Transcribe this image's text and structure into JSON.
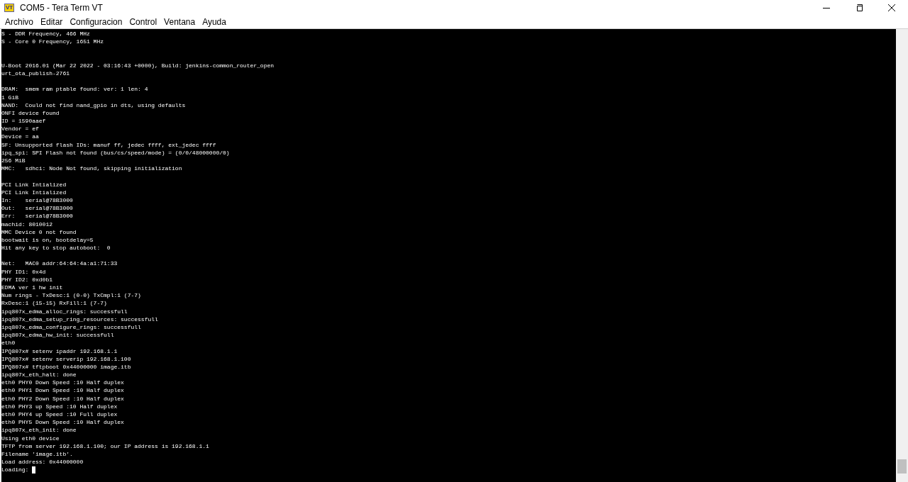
{
  "window": {
    "title": "COM5 - Tera Term VT",
    "app_icon_text": "VT"
  },
  "menu": [
    "Archivo",
    "Editar",
    "Configuracion",
    "Control",
    "Ventana",
    "Ayuda"
  ],
  "terminal": {
    "cursor_visible": true,
    "lines": [
      {
        "kind": "text",
        "text": "S - DDR Frequency, 466 MHz"
      },
      {
        "kind": "text",
        "text": "S - Core 0 Frequency, 1651 MHz"
      },
      {
        "kind": "blank"
      },
      {
        "kind": "blank"
      },
      {
        "kind": "text",
        "text": "U-Boot 2016.01 (Mar 22 2022 - 03:16:43 +0000), Build: jenkins-common_router_open"
      },
      {
        "kind": "text",
        "text": "urt_ota_publish-2761"
      },
      {
        "kind": "blank"
      },
      {
        "kind": "text",
        "text": "DRAM:  smem ram ptable found: ver: 1 len: 4"
      },
      {
        "kind": "text",
        "text": "1 GiB"
      },
      {
        "kind": "text",
        "text": "NAND:  Could not find nand_gpio in dts, using defaults"
      },
      {
        "kind": "text",
        "text": "ONFI device found"
      },
      {
        "kind": "text",
        "text": "ID = 1590aaef"
      },
      {
        "kind": "text",
        "text": "Vendor = ef"
      },
      {
        "kind": "text",
        "text": "Device = aa"
      },
      {
        "kind": "text",
        "text": "SF: Unsupported flash IDs: manuf ff, jedec ffff, ext_jedec ffff"
      },
      {
        "kind": "text",
        "text": "ipq_spi: SPI Flash not found (bus/cs/speed/mode) = (0/0/48000000/0)"
      },
      {
        "kind": "text",
        "text": "256 MiB"
      },
      {
        "kind": "text",
        "text": "MMC:   sdhci: Node Not found, skipping initialization"
      },
      {
        "kind": "blank"
      },
      {
        "kind": "text",
        "text": "PCI Link Intialized"
      },
      {
        "kind": "text",
        "text": "PCI Link Intialized"
      },
      {
        "kind": "text",
        "text": "In:    serial@78B3000"
      },
      {
        "kind": "text",
        "text": "Out:   serial@78B3000"
      },
      {
        "kind": "text",
        "text": "Err:   serial@78B3000"
      },
      {
        "kind": "text",
        "text": "machid: 8010012"
      },
      {
        "kind": "text",
        "text": "MMC Device 0 not found"
      },
      {
        "kind": "text",
        "text": "bootwait is on, bootdelay=5"
      },
      {
        "kind": "text",
        "text": "Hit any key to stop autoboot:  0"
      },
      {
        "kind": "blank"
      },
      {
        "kind": "text",
        "text": "Net:   MAC0 addr:64:64:4a:a1:71:33"
      },
      {
        "kind": "text",
        "text": "PHY ID1: 0x4d"
      },
      {
        "kind": "text",
        "text": "PHY ID2: 0xd0b1"
      },
      {
        "kind": "text",
        "text": "EDMA ver 1 hw init"
      },
      {
        "kind": "text",
        "text": "Num rings - TxDesc:1 (0-0) TxCmpl:1 (7-7)"
      },
      {
        "kind": "text",
        "text": "RxDesc:1 (15-15) RxFill:1 (7-7)"
      },
      {
        "kind": "text",
        "text": "ipq807x_edma_alloc_rings: successfull"
      },
      {
        "kind": "text",
        "text": "ipq807x_edma_setup_ring_resources: successfull"
      },
      {
        "kind": "text",
        "text": "ipq807x_edma_configure_rings: successfull"
      },
      {
        "kind": "text",
        "text": "ipq807x_edma_hw_init: successfull"
      },
      {
        "kind": "text",
        "text": "eth0"
      },
      {
        "kind": "text",
        "text": "IPQ807x# setenv ipaddr 192.168.1.1"
      },
      {
        "kind": "text",
        "text": "IPQ807x# setenv serverip 192.168.1.100"
      },
      {
        "kind": "text",
        "text": "IPQ807x# tftpboot 0x44000000 image.itb"
      },
      {
        "kind": "text",
        "text": "ipq807x_eth_halt: done"
      },
      {
        "kind": "text",
        "text": "eth0 PHY0 Down Speed :10 Half duplex"
      },
      {
        "kind": "text",
        "text": "eth0 PHY1 Down Speed :10 Half duplex"
      },
      {
        "kind": "text",
        "text": "eth0 PHY2 Down Speed :10 Half duplex"
      },
      {
        "kind": "text",
        "text": "eth0 PHY3 up Speed :10 Half duplex"
      },
      {
        "kind": "text",
        "text": "eth0 PHY4 up Speed :10 Full duplex"
      },
      {
        "kind": "text",
        "text": "eth0 PHY5 Down Speed :10 Half duplex"
      },
      {
        "kind": "text",
        "text": "ipq807x_eth_init: done"
      },
      {
        "kind": "text",
        "text": "Using eth0 device"
      },
      {
        "kind": "text",
        "text": "TFTP from server 192.168.1.100; our IP address is 192.168.1.1"
      },
      {
        "kind": "text",
        "text": "Filename 'image.itb'."
      },
      {
        "kind": "text",
        "text": "Load address: 0x44000000"
      },
      {
        "kind": "text",
        "text": "Loading:"
      }
    ]
  }
}
